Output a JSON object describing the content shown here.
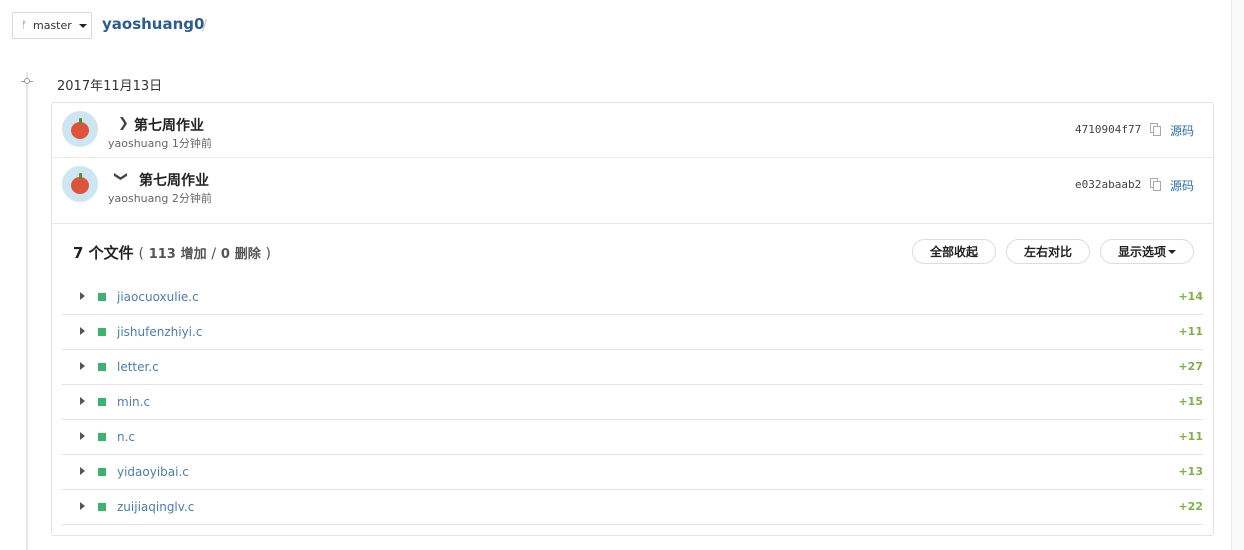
{
  "branch": {
    "icon": "branch-icon",
    "label": "master"
  },
  "repo": {
    "name": "yaoshuang0",
    "separator": "/"
  },
  "timeline": {
    "date": "2017年11月13日"
  },
  "commits": [
    {
      "title": "第七周作业",
      "meta": "yaoshuang 1分钟前",
      "sha": "4710904f77",
      "source": "源码",
      "expanded": false
    },
    {
      "title": "第七周作业",
      "meta": "yaoshuang 2分钟前",
      "sha": "e032abaab2",
      "source": "源码",
      "expanded": true
    }
  ],
  "files_summary": {
    "count_label": "7 个文件",
    "open_paren": "(",
    "additions": "113",
    "add_word": "增加",
    "slash": "/",
    "deletions": "0",
    "del_word": "删除",
    "close_paren": ")"
  },
  "buttons": {
    "collapse_all": "全部收起",
    "side_by_side": "左右对比",
    "display_options": "显示选项"
  },
  "files": [
    {
      "name": "jiaocuoxulie.c",
      "adds": "+14"
    },
    {
      "name": "jishufenzhiyi.c",
      "adds": "+11"
    },
    {
      "name": "letter.c",
      "adds": "+27"
    },
    {
      "name": "min.c",
      "adds": "+15"
    },
    {
      "name": "n.c",
      "adds": "+11"
    },
    {
      "name": "yidaoyibai.c",
      "adds": "+13"
    },
    {
      "name": "zuijiaqinglv.c",
      "adds": "+22"
    }
  ],
  "colors": {
    "link": "#2d5c91",
    "added": "#7cb342",
    "file_status": "#3cb371"
  }
}
